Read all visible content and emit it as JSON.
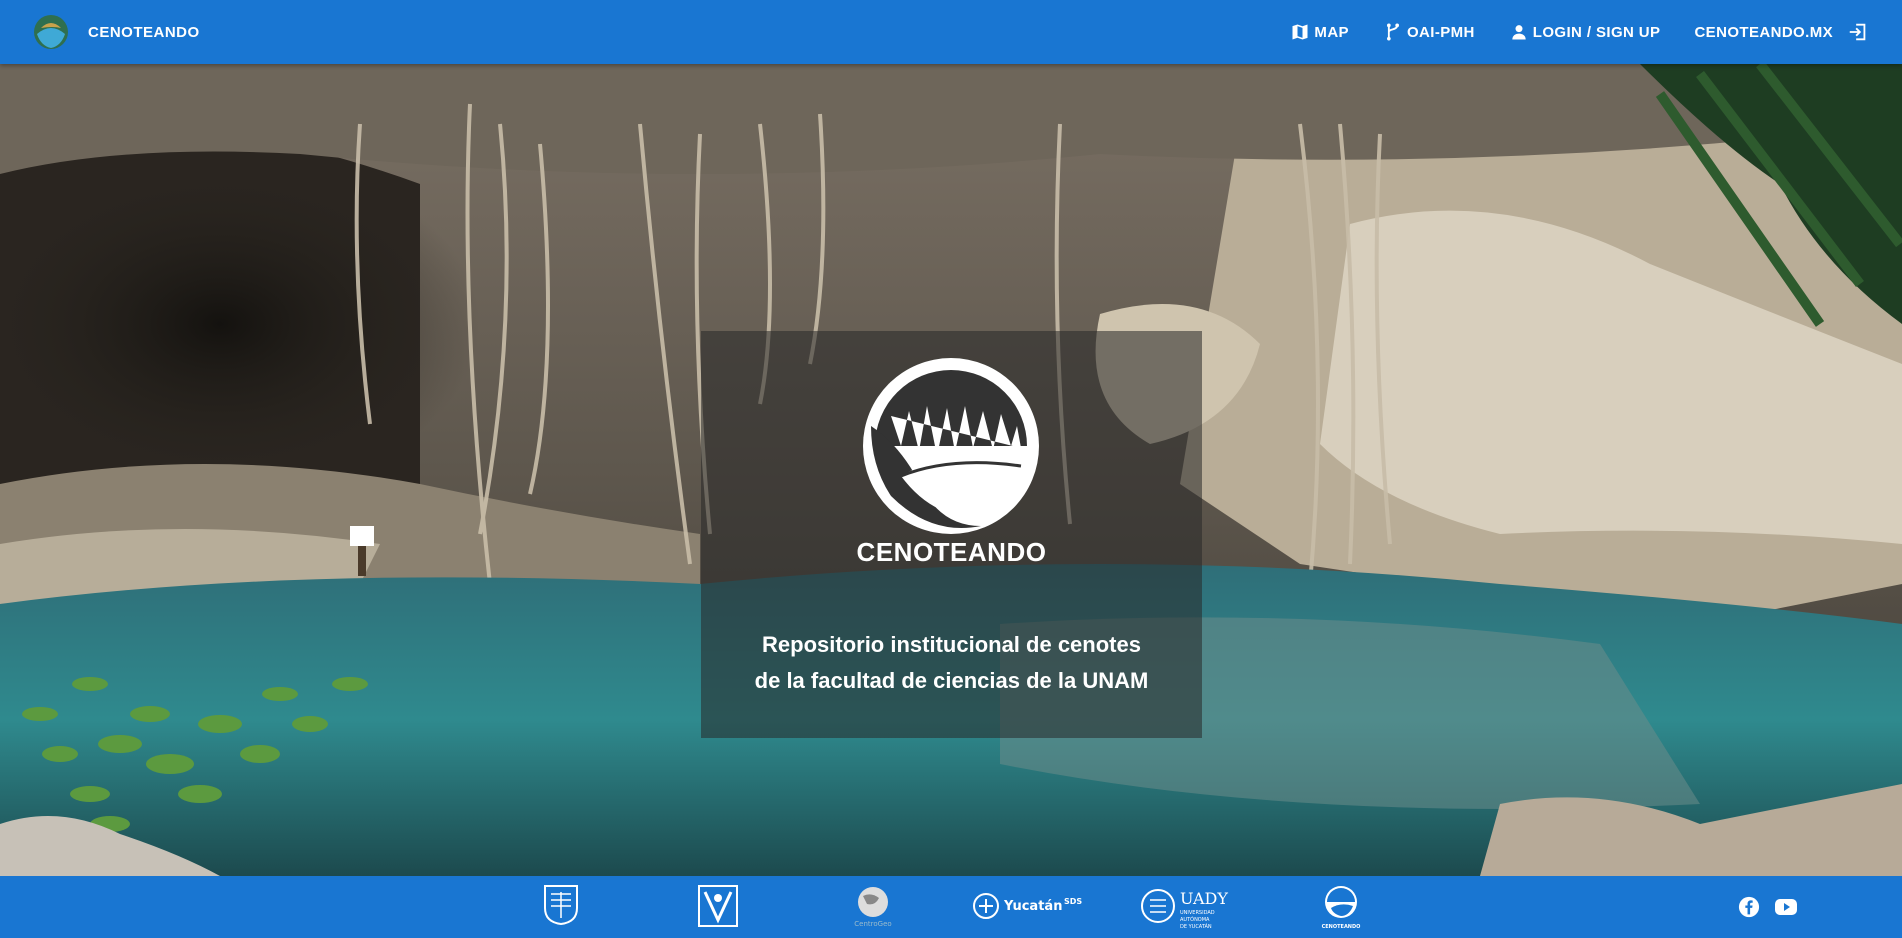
{
  "navbar": {
    "brand": "CENOTEANDO",
    "links": {
      "map": "MAP",
      "oai": "OAI-PMH",
      "login": "LOGIN / SIGN UP",
      "site": "CENOTEANDO.MX"
    }
  },
  "hero": {
    "logo_text": "CENOTEANDO",
    "tagline_line1": "Repositorio institucional de cenotes",
    "tagline_line2": "de la facultad de ciencias de la UNAM"
  },
  "footer": {
    "partners": [
      {
        "name": "unam-logo"
      },
      {
        "name": "facultad-ciencias-logo"
      },
      {
        "name": "centrogeo-logo",
        "label": "CentroGeo"
      },
      {
        "name": "yucatan-sds-logo",
        "label": "Yucatán"
      },
      {
        "name": "uady-logo",
        "label": "UADY"
      },
      {
        "name": "cenoteando-footer-logo",
        "label": "CENOTEANDO"
      }
    ],
    "social": [
      "facebook-icon",
      "youtube-icon"
    ]
  },
  "colors": {
    "primary": "#1976d2",
    "text": "#ffffff"
  }
}
